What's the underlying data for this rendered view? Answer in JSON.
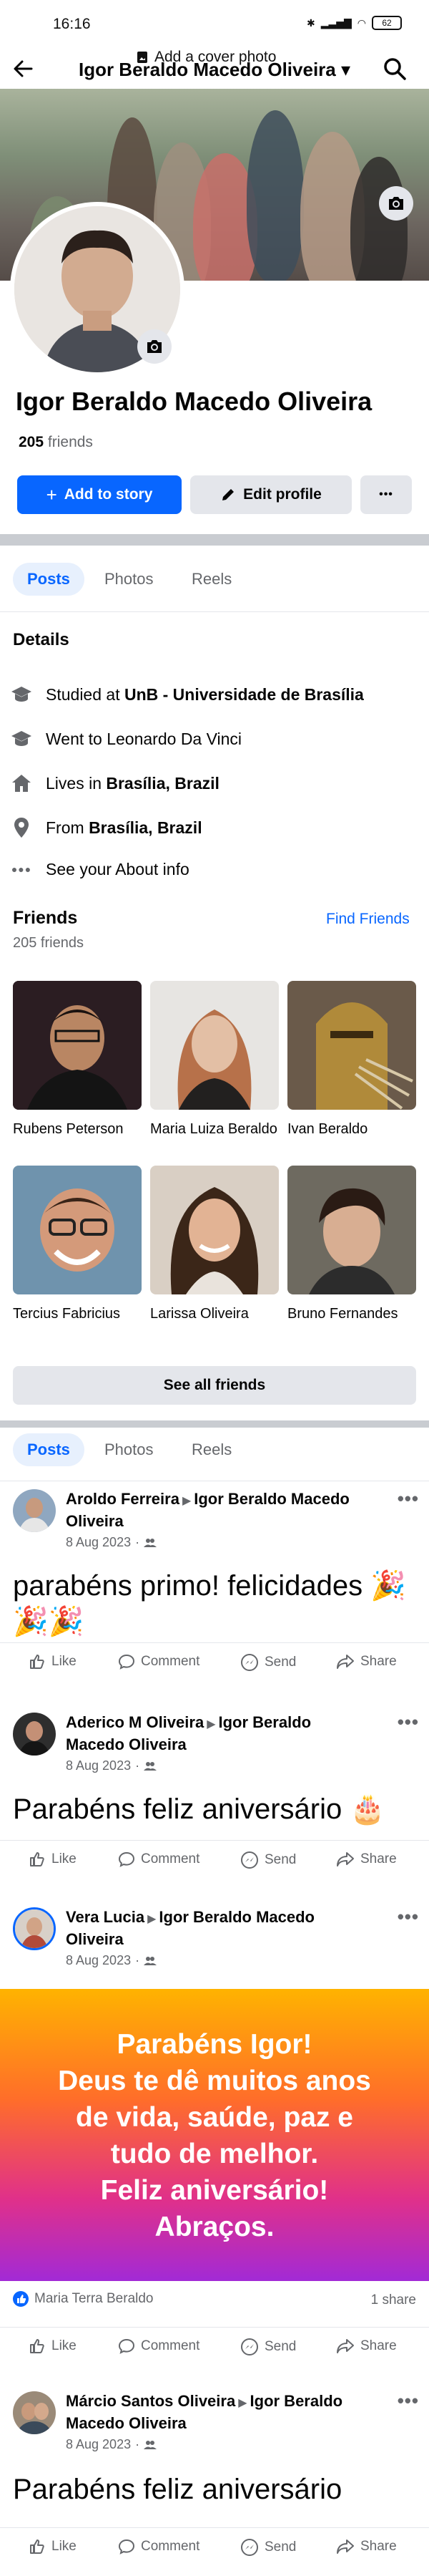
{
  "status_bar": {
    "time": "16:16",
    "battery": "62"
  },
  "header": {
    "title": "Igor Beraldo Macedo Oliveira ▾"
  },
  "cover": {
    "add_cover_label": "Add a cover photo"
  },
  "profile": {
    "name": "Igor Beraldo Macedo Oliveira",
    "friends_number": "205",
    "friends_word": "friends"
  },
  "buttons": {
    "add_story": "Add to story",
    "edit_profile": "Edit profile",
    "more": "•••"
  },
  "tabs": [
    "Posts",
    "Photos",
    "Reels"
  ],
  "details": {
    "title": "Details",
    "studied_prefix": "Studied at ",
    "studied_value": "UnB - Universidade de Brasília",
    "went_to": "Went to Leonardo Da Vinci",
    "lives_prefix": "Lives in ",
    "lives_value": "Brasília, Brazil",
    "from_prefix": "From ",
    "from_value": "Brasília, Brazil",
    "about": "See your About info"
  },
  "friends": {
    "title": "Friends",
    "subtitle": "205 friends",
    "find_friends": "Find Friends",
    "see_all": "See all friends",
    "list": [
      {
        "name": "Rubens Peterson"
      },
      {
        "name": "Maria Luiza Beraldo"
      },
      {
        "name": "Ivan Beraldo"
      },
      {
        "name": "Tercius Fabricius"
      },
      {
        "name": "Larissa Oliveira"
      },
      {
        "name": "Bruno Fernandes"
      }
    ]
  },
  "actions": {
    "like": "Like",
    "comment": "Comment",
    "send": "Send",
    "share": "Share"
  },
  "posts": [
    {
      "from": "Aroldo Ferreira",
      "to": "Igor Beraldo Macedo Oliveira",
      "date": "8 Aug 2023",
      "text": "parabéns primo! felicidades 🎉🎉🎉"
    },
    {
      "from": "Aderico M Oliveira",
      "to": "Igor Beraldo Macedo Oliveira",
      "date": "8 Aug 2023",
      "text": "Parabéns feliz aniversário 🎂"
    },
    {
      "from": "Vera Lucia",
      "to": "Igor Beraldo Macedo Oliveira",
      "date": "8 Aug 2023",
      "banner_lines": [
        "Parabéns Igor!",
        "Deus te dê muitos anos",
        "de vida, saúde, paz e",
        "tudo de melhor.",
        "Feliz aniversário!",
        "Abraços."
      ],
      "reactor": "Maria Terra Beraldo",
      "shares": "1 share"
    },
    {
      "from": "Márcio Santos Oliveira",
      "to": "Igor Beraldo Macedo Oliveira",
      "date": "8 Aug 2023",
      "text": "Parabéns feliz aniversário"
    }
  ],
  "colors": {
    "accent": "#0866ff",
    "secondary_text": "#65676b",
    "button_gray": "#e4e6eb"
  },
  "icons": [
    "back-arrow-icon",
    "search-icon",
    "camera-icon",
    "graduation-cap-icon",
    "home-icon",
    "location-pin-icon",
    "ellipsis-icon",
    "like-icon",
    "comment-icon",
    "messenger-icon",
    "share-icon",
    "friends-audience-icon",
    "plus-icon",
    "pencil-icon"
  ]
}
